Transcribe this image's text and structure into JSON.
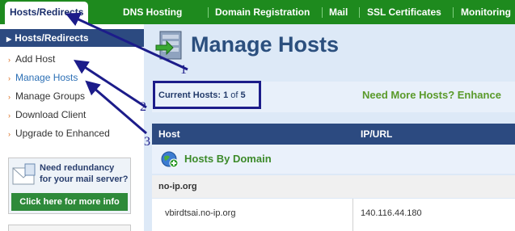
{
  "nav": {
    "tabs": [
      {
        "label": "Hosts/Redirects",
        "active": true
      },
      {
        "label": "DNS Hosting"
      },
      {
        "label": "Domain Registration"
      },
      {
        "label": "Mail"
      },
      {
        "label": "SSL Certificates"
      },
      {
        "label": "Monitoring"
      }
    ]
  },
  "sidebar": {
    "header": "Hosts/Redirects",
    "items": [
      {
        "label": "Add Host"
      },
      {
        "label": "Manage Hosts",
        "current": true
      },
      {
        "label": "Manage Groups"
      },
      {
        "label": "Download Client"
      },
      {
        "label": "Upgrade to Enhanced"
      }
    ],
    "promo": {
      "text": "Need redundancy for your mail server?",
      "button": "Click here for more info"
    }
  },
  "main": {
    "title": "Manage Hosts",
    "stats": {
      "label": "Current Hosts:",
      "current": "1",
      "of": "of",
      "max": "5"
    },
    "upsell": "Need More Hosts? Enhance",
    "table": {
      "columns": [
        "Host",
        "IP/URL"
      ],
      "group": "Hosts By Domain",
      "domain": "no-ip.org",
      "rows": [
        {
          "host": "vbirdtsai.no-ip.org",
          "ip": "140.116.44.180"
        }
      ]
    }
  },
  "annotations": {
    "labels": [
      "1",
      "2",
      "3"
    ],
    "color": "#1c1c8a"
  }
}
